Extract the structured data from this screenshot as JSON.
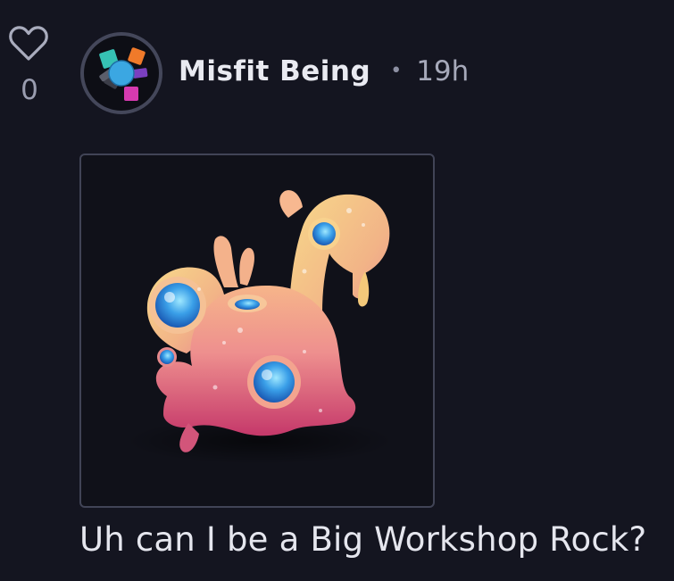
{
  "post": {
    "likes": {
      "count": "0",
      "icon": "heart-outline-icon"
    },
    "author": {
      "name": "Misfit Being",
      "avatar_icon": "multicolor-logo-avatar"
    },
    "separator": "•",
    "timestamp": "19h",
    "image": {
      "subject": "pink-slime-creature-icon"
    },
    "caption": "Uh can I be a Big Workshop Rock?"
  },
  "colors": {
    "background": "#141520",
    "text_primary": "#e9eaf1",
    "text_muted": "#a6a9ba",
    "frame_border": "#414456",
    "creature_pink": "#d9577f",
    "creature_yellow": "#f1c86a",
    "eye_blue": "#2f8fe0"
  }
}
